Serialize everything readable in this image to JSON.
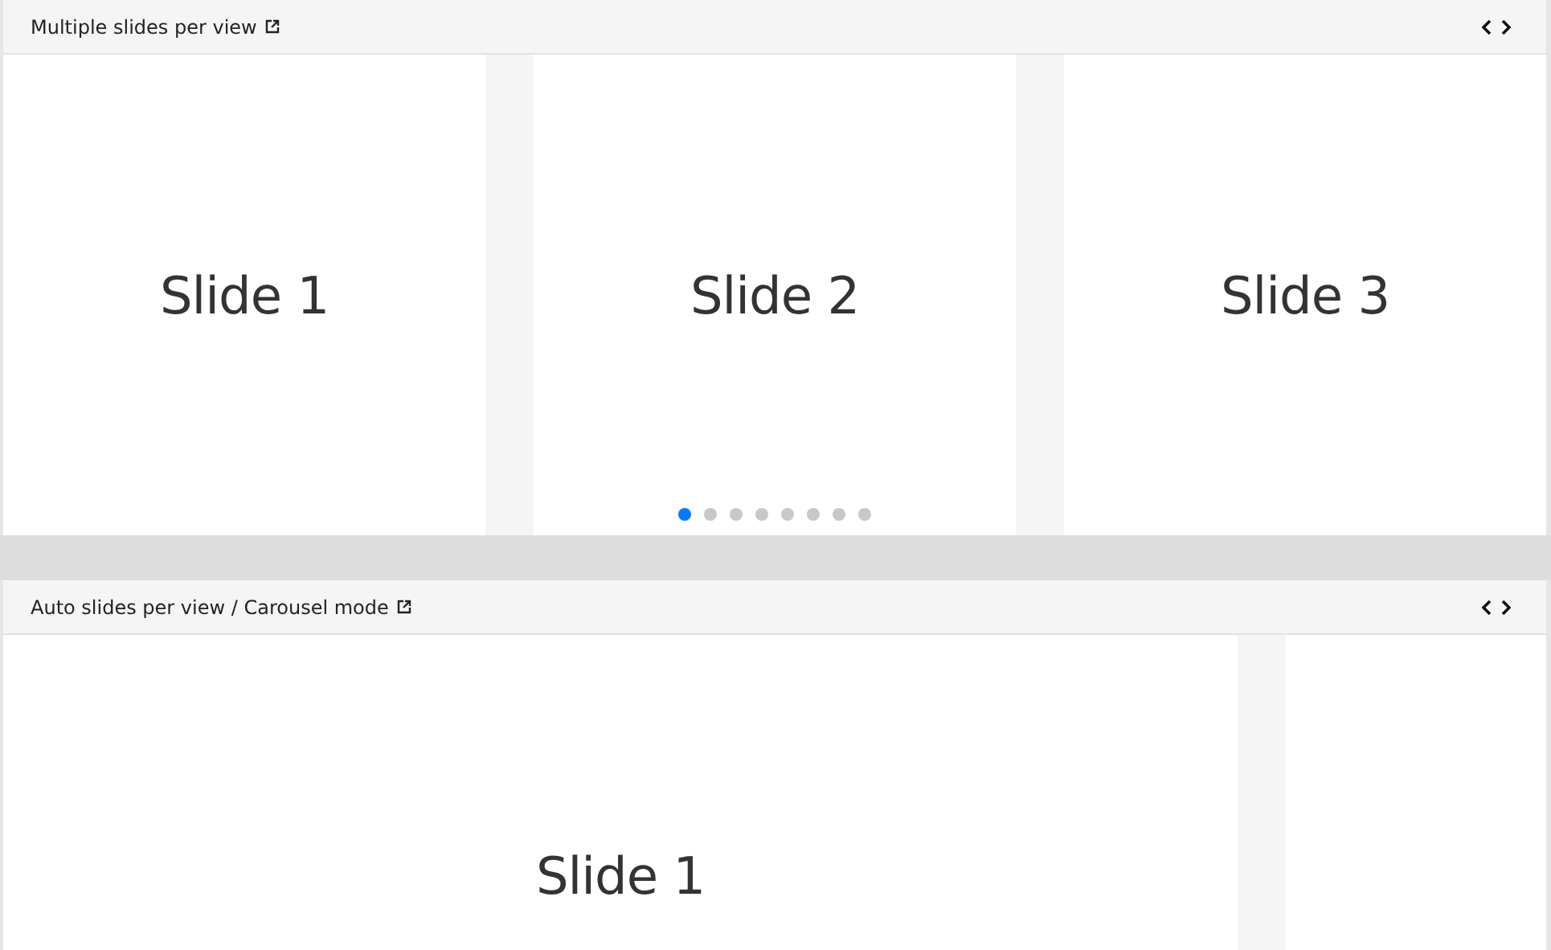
{
  "demos": [
    {
      "title": "Multiple slides per view",
      "kind": "multiple",
      "slides": [
        "Slide 1",
        "Slide 2",
        "Slide 3"
      ],
      "pagination": [
        {
          "selected": true
        },
        {
          "selected": false
        },
        {
          "selected": false
        },
        {
          "selected": false
        },
        {
          "selected": false
        },
        {
          "selected": false
        },
        {
          "selected": false
        },
        {
          "selected": false
        }
      ]
    },
    {
      "title": "Auto slides per view / Carousel mode",
      "kind": "auto",
      "slides": [
        "Slide 1"
      ],
      "next_slide_peek": true
    }
  ]
}
